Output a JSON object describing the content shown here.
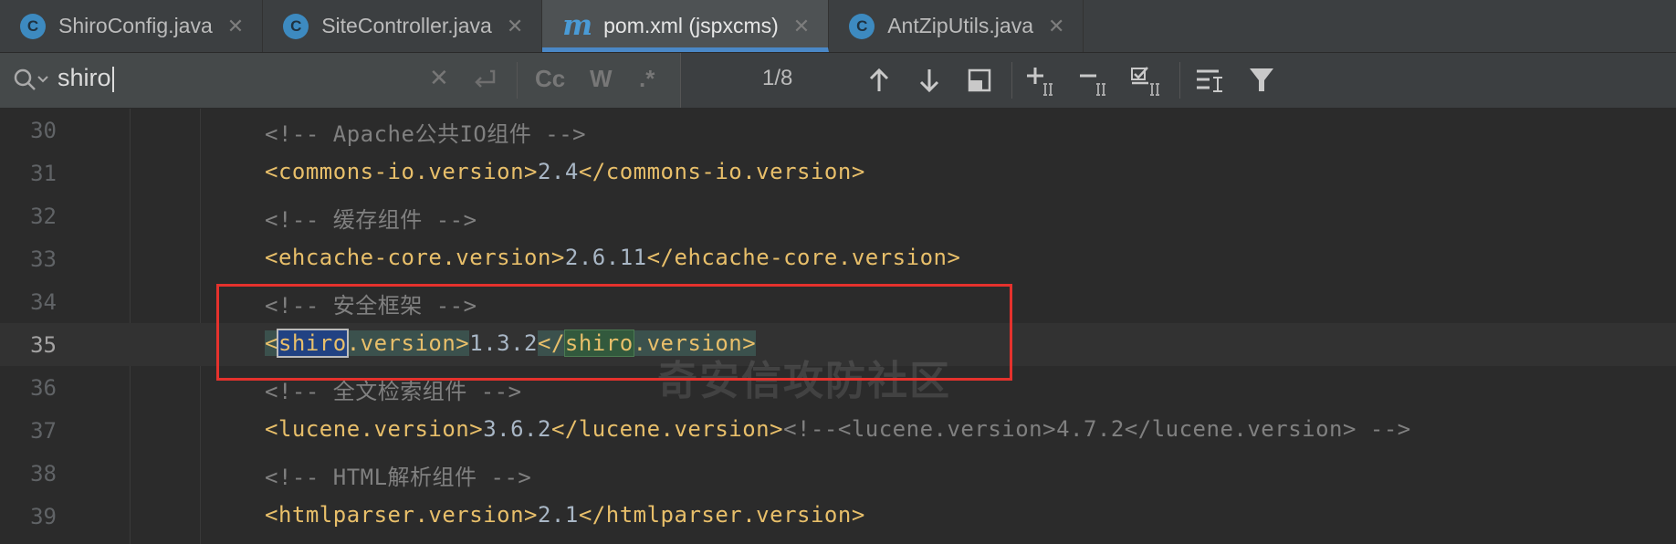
{
  "tabs": [
    {
      "label": "ShiroConfig.java",
      "icon": "java-class-icon",
      "active": false
    },
    {
      "label": "SiteController.java",
      "icon": "java-class-icon",
      "active": false
    },
    {
      "label": "pom.xml (jspxcms)",
      "icon": "maven-icon",
      "active": true
    },
    {
      "label": "AntZipUtils.java",
      "icon": "java-class-icon",
      "active": false
    }
  ],
  "tab_close_glyph": "✕",
  "class_icon_letter": "C",
  "maven_icon_letter": "m",
  "find": {
    "query": "shiro",
    "match_case_label": "Cc",
    "words_label": "W",
    "regex_label": ".*",
    "match_count": "1/8"
  },
  "editor": {
    "lines": [
      {
        "num": "30"
      },
      {
        "num": "31"
      },
      {
        "num": "32"
      },
      {
        "num": "33"
      },
      {
        "num": "34"
      },
      {
        "num": "35"
      },
      {
        "num": "36"
      },
      {
        "num": "37"
      },
      {
        "num": "38"
      },
      {
        "num": "39"
      }
    ],
    "code": {
      "l30": "<!-- Apache公共IO组件 -->",
      "l31_open": "<commons-io.version>",
      "l31_val": "2.4",
      "l31_close": "</commons-io.version>",
      "l32": "<!-- 缓存组件 -->",
      "l33_open": "<ehcache-core.version>",
      "l33_val": "2.6.11",
      "l33_close": "</ehcache-core.version>",
      "l34": "<!-- 安全框架 -->",
      "l35_lt": "<",
      "l35_sel": "shiro",
      "l35_rest": ".version>",
      "l35_val": "1.3.2",
      "l35_close_lt": "</",
      "l35_match": "shiro",
      "l35_close_rest": ".version>",
      "l36": "<!-- 全文检索组件 -->",
      "l37_open": "<lucene.version>",
      "l37_val": "3.6.2",
      "l37_close": "</lucene.version>",
      "l37_comment": "<!--<lucene.version>4.7.2</lucene.version> -->",
      "l38": "<!-- HTML解析组件 -->",
      "l39_open": "<htmlparser.version>",
      "l39_val": "2.1",
      "l39_close": "</htmlparser.version>"
    }
  },
  "watermark": "奇安信攻防社区",
  "colors": {
    "background": "#2b2b2b",
    "tag": "#e8bf6a",
    "comment": "#808080",
    "text": "#a9b7c6",
    "highlight_box": "#e5322d",
    "active_tab_underline": "#4a88c7"
  }
}
